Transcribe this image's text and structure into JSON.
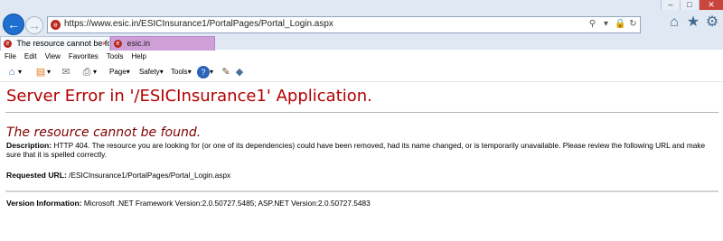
{
  "window": {
    "controls": [
      "–",
      "□",
      "✕"
    ]
  },
  "navigation": {
    "url": "https://www.esic.in/ESICInsurance1/PortalPages/Portal_Login.aspx",
    "address_icons": [
      "search-icon",
      "dropdown-icon",
      "lock-icon",
      "refresh-icon"
    ],
    "right_icons": [
      "home-icon",
      "favorites-star-icon",
      "settings-gear-icon"
    ]
  },
  "tabs": [
    {
      "label": "The resource cannot be fou...",
      "active": true,
      "close": "×"
    },
    {
      "label": "esic.in",
      "active": false
    }
  ],
  "menu": {
    "items": [
      "File",
      "Edit",
      "View",
      "Favorites",
      "Tools",
      "Help"
    ]
  },
  "command_bar": {
    "page_label": "Page",
    "safety_label": "Safety",
    "tools_label": "Tools",
    "icons": [
      "home-icon",
      "rss-feed-icon",
      "read-mail-icon",
      "print-icon",
      "help-icon",
      "research-icon"
    ]
  },
  "page": {
    "title": "Server Error in '/ESICInsurance1' Application.",
    "subtitle": "The resource cannot be found.",
    "description_label": "Description:",
    "description_text": " HTTP 404. The resource you are looking for (or one of its dependencies) could have been removed, had its name changed, or is temporarily unavailable.  Please review the following URL and make sure that it is spelled correctly.",
    "requested_url_label": "Requested URL:",
    "requested_url_value": " /ESICInsurance1/PortalPages/Portal_Login.aspx",
    "version_label": "Version Information:",
    "version_value": " Microsoft .NET Framework Version:2.0.50727.5485; ASP.NET Version:2.0.50727.5483"
  },
  "colors": {
    "error_title": "#b30000",
    "subtitle": "#800000",
    "browser_chrome": "#dfe8f3",
    "second_tab": "#cf9fd8"
  }
}
